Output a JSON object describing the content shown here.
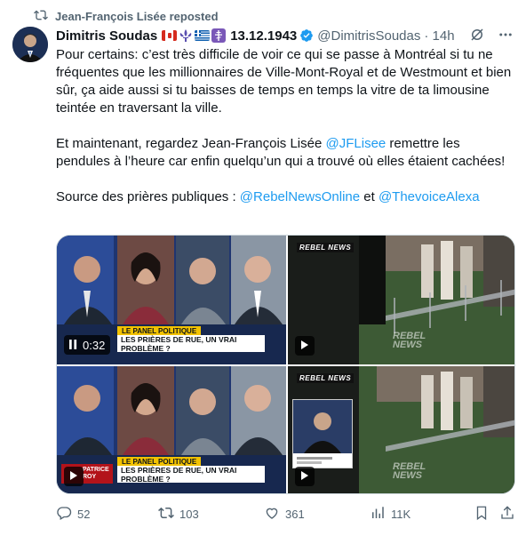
{
  "repost": {
    "icon": "repost-icon",
    "label": "Jean-François Lisée reposted"
  },
  "author": {
    "name": "Dimitris Soudas",
    "flags": [
      "flag-canada",
      "fleur-de-lis",
      "flag-greece",
      "orthodox-cross"
    ],
    "date": "13.12.1943",
    "verified": true,
    "handle": "@DimitrisSoudas",
    "time": "· 14h"
  },
  "tweet": {
    "paragraph1": "Pour certains: c’est très difficile de voir ce qui se passe à Montréal si tu ne fréquentes que les millionnaires de Ville-Mont-Royal et de Westmount et bien sûr, ça aide aussi si tu baisses de temps en temps la vitre de ta limousine teintée en traversant la ville.",
    "paragraph2_before": "Et maintenant, regardez Jean-François Lisée ",
    "paragraph2_mention": "@JFLisee",
    "paragraph2_after": " remettre les pendules à l’heure car enfin quelqu’un qui a trouvé où elles étaient cachées!",
    "paragraph3_before": "Source des prières publiques : ",
    "paragraph3_mention1": "@RebelNewsOnline",
    "paragraph3_mid": " et ",
    "paragraph3_mention2": "@ThevoiceAlexa"
  },
  "media": {
    "video_time": "0:32",
    "panel_label": "LE PANEL POLITIQUE",
    "headline": "LES PRIÈRES DE RUE, UN VRAI PROBLÈME ?",
    "lcn_name_top": "PATRICE",
    "lcn_name_bottom": "ROY",
    "rebel_logo": "REBEL NEWS",
    "watermark_line1": "REBEL",
    "watermark_line2": "NEWS"
  },
  "actions": {
    "replies": "52",
    "reposts": "103",
    "likes": "361",
    "views": "11K"
  },
  "colors": {
    "accent": "#1d9bf0",
    "muted": "#536471",
    "text": "#0f1419"
  }
}
